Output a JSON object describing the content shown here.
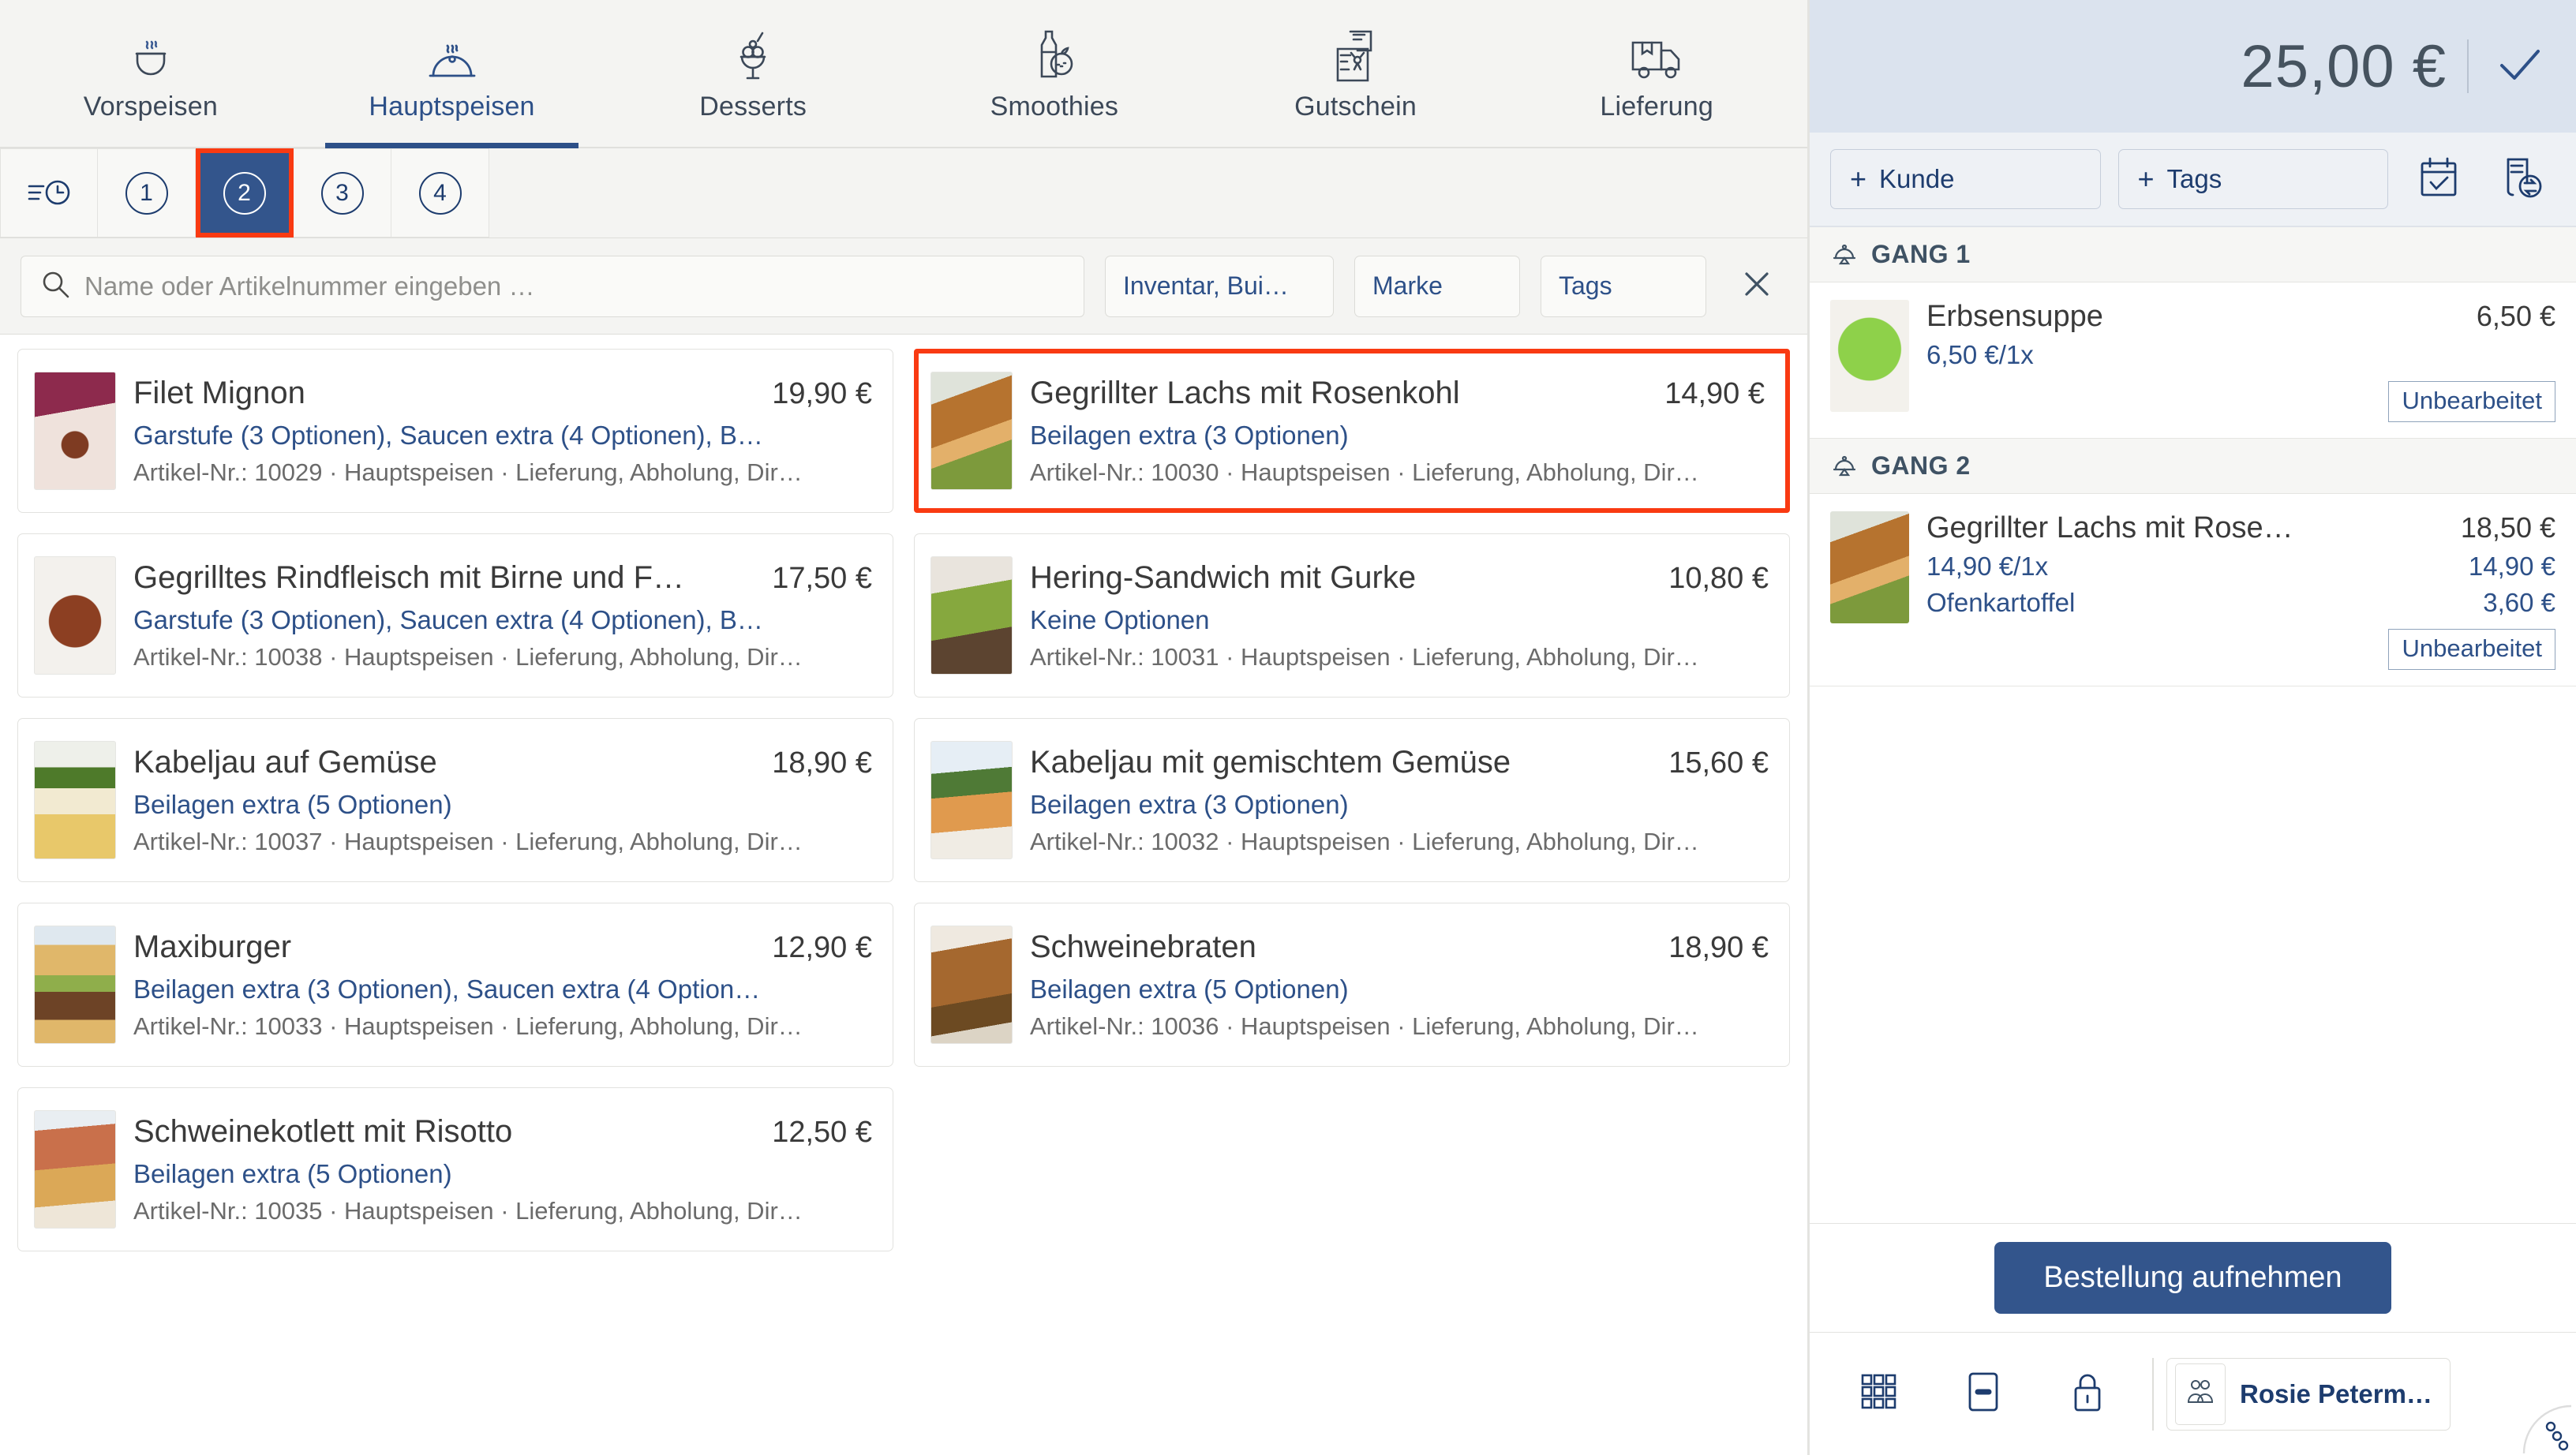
{
  "colors": {
    "accent_blue": "#2d5088",
    "dark_blue": "#1d3c6e",
    "selected_blue": "#33558c",
    "highlight_red": "#f93a12",
    "panel_bg": "#f4f4f2",
    "total_bar_bg": "#dbe3ee"
  },
  "tabs": [
    {
      "label": "Vorspeisen",
      "icon": "soup-bowl-icon",
      "active": false
    },
    {
      "label": "Hauptspeisen",
      "icon": "cloche-icon",
      "active": true
    },
    {
      "label": "Desserts",
      "icon": "sundae-icon",
      "active": false
    },
    {
      "label": "Smoothies",
      "icon": "bottle-fruit-icon",
      "active": false
    },
    {
      "label": "Gutschein",
      "icon": "voucher-icon",
      "active": false
    },
    {
      "label": "Lieferung",
      "icon": "delivery-truck-icon",
      "active": false
    }
  ],
  "courses": {
    "history_icon": "recent-list-icon",
    "items": [
      {
        "label": "1",
        "selected": false
      },
      {
        "label": "2",
        "selected": true
      },
      {
        "label": "3",
        "selected": false
      },
      {
        "label": "4",
        "selected": false
      }
    ]
  },
  "search": {
    "placeholder": "Name oder Artikelnummer eingeben  …",
    "value": "",
    "icon": "search-icon",
    "clear_icon": "close-icon",
    "filters": [
      {
        "label": "Inventar, Bui…",
        "name": "inventory-filter"
      },
      {
        "label": "Marke",
        "name": "brand-filter"
      },
      {
        "label": "Tags",
        "name": "tags-filter"
      }
    ]
  },
  "products": [
    {
      "name": "Filet Mignon",
      "price": "19,90 €",
      "options": "Garstufe (3 Optionen), Saucen extra (4 Optionen), B…",
      "meta": "Artikel-Nr.: 10029 · Hauptspeisen · Lieferung, Abholung, Dir…",
      "selected": false,
      "thumb_colors": [
        "#8d2a4d",
        "#d9c0a0",
        "#6d3a26"
      ]
    },
    {
      "name": "Gegrillter Lachs mit Rosenkohl",
      "price": "14,90 €",
      "options": "Beilagen extra (3 Optionen)",
      "meta": "Artikel-Nr.: 10030 · Hauptspeisen · Lieferung, Abholung, Dir…",
      "selected": true,
      "thumb_colors": [
        "#e7e4dd",
        "#b6732f",
        "#7d9a3c"
      ]
    },
    {
      "name": "Gegrilltes Rindfleisch mit Birne und F…",
      "price": "17,50 €",
      "options": "Garstufe (3 Optionen), Saucen extra (4 Optionen), B…",
      "meta": "Artikel-Nr.: 10038 · Hauptspeisen · Lieferung, Abholung, Dir…",
      "selected": false,
      "thumb_colors": [
        "#f0eeea",
        "#8c3f22",
        "#c98a4b"
      ]
    },
    {
      "name": "Hering-Sandwich mit Gurke",
      "price": "10,80 €",
      "options": "Keine Optionen",
      "meta": "Artikel-Nr.: 10031 · Hauptspeisen · Lieferung, Abholung, Dir…",
      "selected": false,
      "thumb_colors": [
        "#ece8e2",
        "#86a83e",
        "#5c4430"
      ]
    },
    {
      "name": "Kabeljau auf Gemüse",
      "price": "18,90 €",
      "options": "Beilagen extra (5 Optionen)",
      "meta": "Artikel-Nr.: 10037 · Hauptspeisen · Lieferung, Abholung, Dir…",
      "selected": false,
      "thumb_colors": [
        "#f2efe8",
        "#e8c86a",
        "#4e7a2a"
      ]
    },
    {
      "name": "Kabeljau mit gemischtem Gemüse",
      "price": "15,60 €",
      "options": "Beilagen extra (3 Optionen)",
      "meta": "Artikel-Nr.: 10032 · Hauptspeisen · Lieferung, Abholung, Dir…",
      "selected": false,
      "thumb_colors": [
        "#e6eef5",
        "#e09a4e",
        "#4f7a36"
      ]
    },
    {
      "name": "Maxiburger",
      "price": "12,90 €",
      "options": "Beilagen extra (3 Optionen), Saucen extra (4 Option…",
      "meta": "Artikel-Nr.: 10033 · Hauptspeisen · Lieferung, Abholung, Dir…",
      "selected": false,
      "thumb_colors": [
        "#dfe8ef",
        "#e0b76a",
        "#6d4326"
      ]
    },
    {
      "name": "Schweinebraten",
      "price": "18,90 €",
      "options": "Beilagen extra (5 Optionen)",
      "meta": "Artikel-Nr.: 10036 · Hauptspeisen · Lieferung, Abholung, Dir…",
      "selected": false,
      "thumb_colors": [
        "#efe9e0",
        "#a5682f",
        "#6c4a22"
      ]
    },
    {
      "name": "Schweinekotlett mit Risotto",
      "price": "12,50 €",
      "options": "Beilagen extra (5 Optionen)",
      "meta": "Artikel-Nr.: 10035 · Hauptspeisen · Lieferung, Abholung, Dir…",
      "selected": false,
      "thumb_colors": [
        "#e9eef2",
        "#c9704b",
        "#dba857"
      ]
    }
  ],
  "order": {
    "total": "25,00 €",
    "confirm_icon": "check-icon",
    "add_customer_label": "Kunde",
    "add_tags_label": "Tags",
    "plus_symbol": "+",
    "calendar_icon": "calendar-check-icon",
    "receipt_icon": "receipt-exchange-icon",
    "courses": [
      {
        "title": "GANG 1",
        "icon": "cloche-small-icon",
        "items": [
          {
            "name": "Erbsensuppe",
            "price": "6,50 €",
            "unit": "6,50 €/1x",
            "status": "Unbearbeitet",
            "extras": [],
            "thumb_colors": [
              "#f3f1ec",
              "#8ed14a",
              "#ffffff"
            ]
          }
        ]
      },
      {
        "title": "GANG 2",
        "icon": "cloche-small-icon",
        "items": [
          {
            "name": "Gegrillter Lachs mit Rose…",
            "price": "18,50 €",
            "unit": "14,90 €/1x",
            "unit_price": "14,90 €",
            "status": "Unbearbeitet",
            "extras": [
              {
                "label": "Ofenkartoffel",
                "price": "3,60 €"
              }
            ],
            "thumb_colors": [
              "#e7e4dd",
              "#b6732f",
              "#7d9a3c"
            ]
          }
        ]
      }
    ],
    "cta_label": "Bestellung aufnehmen"
  },
  "footer": {
    "keypad_icon": "grid-keypad-icon",
    "minus_icon": "minus-box-icon",
    "lock_icon": "lock-icon",
    "user_icon": "users-icon",
    "user_name": "Rosie Peterm…",
    "corner_icon": "dots-corner-icon"
  }
}
